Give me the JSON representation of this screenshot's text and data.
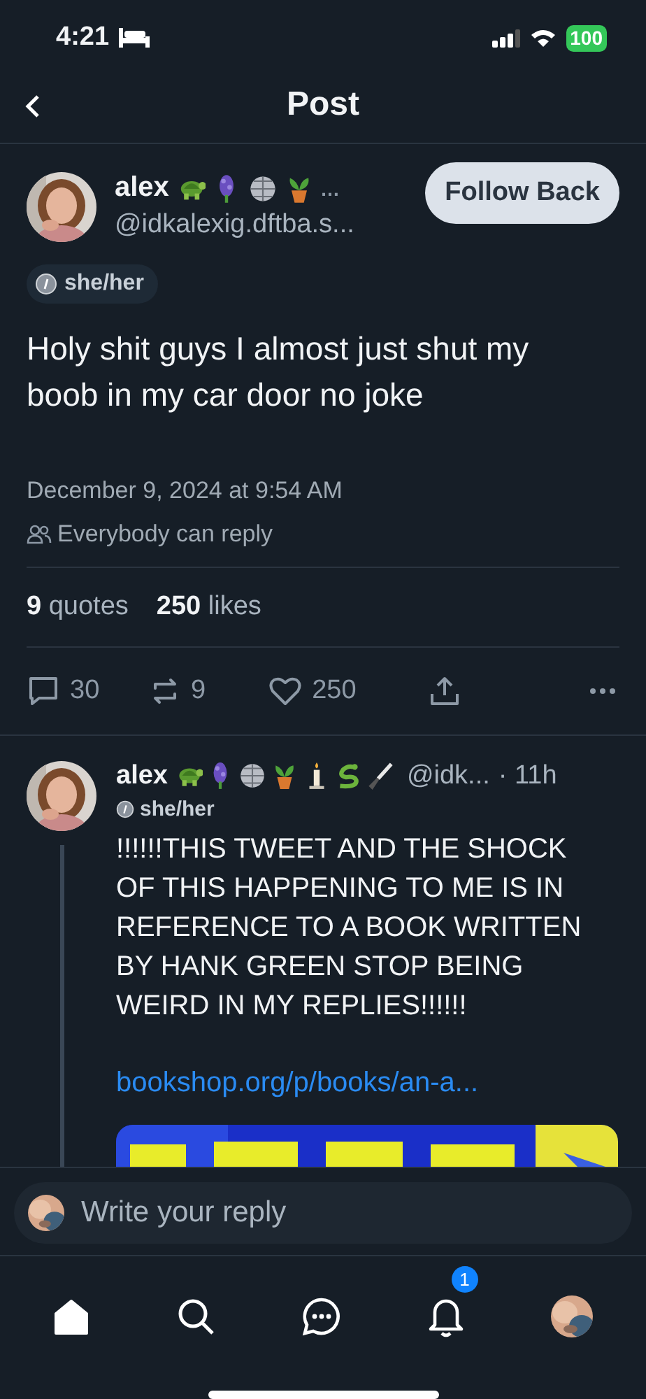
{
  "status_bar": {
    "time": "4:21",
    "battery": "100"
  },
  "header": {
    "title": "Post"
  },
  "post": {
    "author": {
      "name": "alex",
      "name_more": "…",
      "handle": "@idkalexig.dftba.s..."
    },
    "follow_button": "Follow Back",
    "pronouns": "she/her",
    "text": "Holy shit guys I almost just shut my boob in my car door no joke",
    "timestamp": "December 9, 2024 at 9:54 AM",
    "reply_setting": "Everybody can reply",
    "stats": [
      {
        "count": "9",
        "label": "quotes"
      },
      {
        "count": "250",
        "label": "likes"
      }
    ],
    "actions": [
      {
        "kind": "reply",
        "count": "30"
      },
      {
        "kind": "repost",
        "count": "9"
      },
      {
        "kind": "like",
        "count": "250"
      },
      {
        "kind": "share"
      },
      {
        "kind": "more"
      }
    ]
  },
  "reply": {
    "author": {
      "name": "alex",
      "handle": "@idk...",
      "time": "· 11h"
    },
    "pronouns": "she/her",
    "text": "!!!!!!THIS TWEET AND THE SHOCK OF THIS HAPPENING TO ME IS IN REFERENCE TO A BOOK WRITTEN BY HANK GREEN STOP BEING WEIRD IN MY REPLIES!!!!!!",
    "link": "bookshop.org/p/books/an-a..."
  },
  "composer": {
    "placeholder": "Write your reply"
  },
  "tab_bar": [
    {
      "kind": "home",
      "selected": true
    },
    {
      "kind": "search",
      "selected": false
    },
    {
      "kind": "chat",
      "selected": false
    },
    {
      "kind": "notifications",
      "selected": false,
      "badge": "1"
    },
    {
      "kind": "profile",
      "selected": false
    }
  ]
}
